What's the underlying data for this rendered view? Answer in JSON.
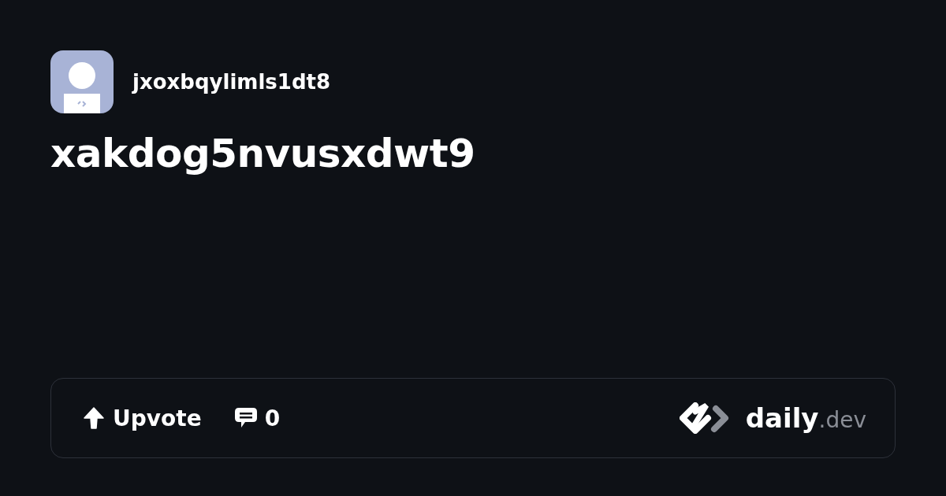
{
  "author": {
    "username": "jxoxbqylimls1dt8"
  },
  "post": {
    "title": "xakdog5nvusxdwt9"
  },
  "footer": {
    "upvote_label": "Upvote",
    "comment_count": "0",
    "brand": {
      "name": "daily",
      "suffix": ".dev"
    }
  }
}
